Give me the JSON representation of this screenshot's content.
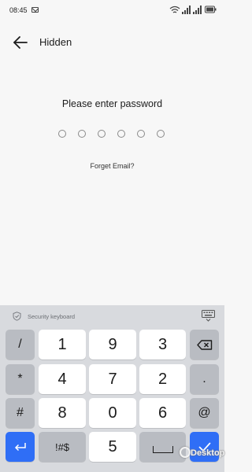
{
  "status_bar": {
    "time": "08:45",
    "icons": [
      "mail-icon",
      "wifi-icon",
      "signal-icon",
      "battery-icon"
    ]
  },
  "header": {
    "back_icon": "arrow-left-icon",
    "title": "Hidden"
  },
  "password": {
    "prompt": "Please enter password",
    "length": 6,
    "entered": 0,
    "forget_link": "Forget Email?"
  },
  "keyboard": {
    "label": "Security keyboard",
    "accent_color": "#2f6ef6",
    "rows": [
      [
        "/",
        "1",
        "9",
        "3",
        "backspace"
      ],
      [
        "*",
        "4",
        "7",
        "2",
        "."
      ],
      [
        "#",
        "8",
        "0",
        "6",
        "@"
      ],
      [
        "enter",
        "!#$",
        "5",
        "space",
        "done"
      ]
    ],
    "keys": {
      "r1": {
        "k1": "/",
        "k2": "1",
        "k3": "9",
        "k4": "3"
      },
      "r2": {
        "k1": "*",
        "k2": "4",
        "k3": "7",
        "k4": "2",
        "k5": "."
      },
      "r3": {
        "k1": "#",
        "k2": "8",
        "k3": "0",
        "k4": "6",
        "k5": "@"
      },
      "r4": {
        "k2": "!#$",
        "k3": "5"
      }
    }
  },
  "watermark": {
    "text": "Desktop"
  }
}
